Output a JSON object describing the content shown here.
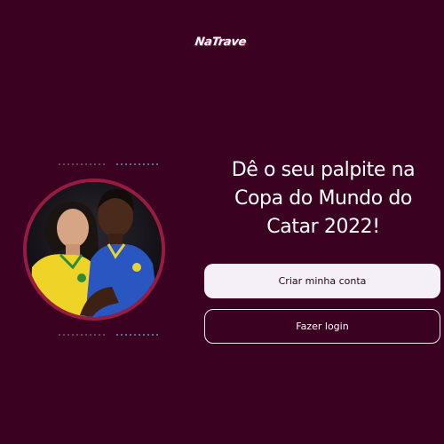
{
  "brand": {
    "logo_text": "NaTrave"
  },
  "hero": {
    "headline": "Dê o seu palpite na Copa do Mundo do Catar 2022!",
    "image_icon": "player-photo"
  },
  "actions": {
    "create_account_label": "Criar minha conta",
    "login_label": "Fazer login"
  },
  "colors": {
    "background": "#3b0121",
    "accent": "#9a1b40",
    "primary_button_bg": "#f5eff8"
  }
}
